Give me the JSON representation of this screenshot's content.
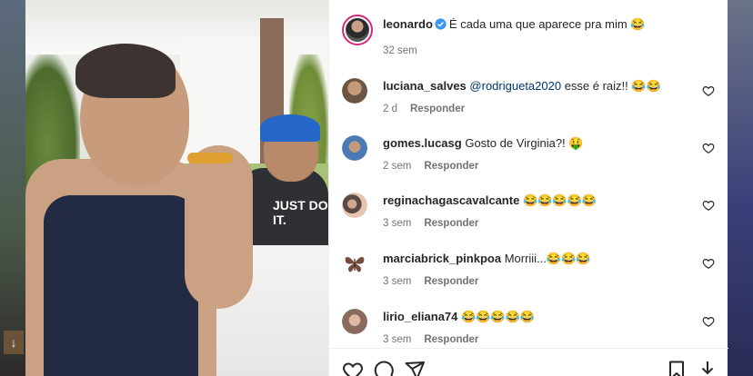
{
  "post": {
    "author": "leonardo",
    "caption": "É cada uma que aparece pra mim 😂",
    "time": "32 sem",
    "shirt_text": "JUST DO IT."
  },
  "reply_label": "Responder",
  "comments": [
    {
      "user": "luciana_salves",
      "mention": "@rodrigueta2020",
      "text": " esse é raiz!! 😂😂",
      "time": "2 d"
    },
    {
      "user": "gomes.lucasg",
      "mention": "",
      "text": "Gosto de Virginia?! 🤑",
      "time": "2 sem"
    },
    {
      "user": "reginachagascavalcante",
      "mention": "",
      "text": "😂😂😂😂😂",
      "time": "3 sem"
    },
    {
      "user": "marciabrick_pinkpoa",
      "mention": "",
      "text": "Morriii...😂😂😂",
      "time": "3 sem"
    },
    {
      "user": "lirio_eliana74",
      "mention": "",
      "text": "😂😂😂😂😂",
      "time": "3 sem"
    }
  ],
  "colors": {
    "verified": "#3897f0",
    "story_ring": "#d62976",
    "link": "#00376b",
    "muted": "#737373"
  },
  "icons": {
    "like": "heart-outline-icon",
    "comment": "speech-bubble-icon",
    "share": "paper-plane-icon",
    "save": "bookmark-icon",
    "download": "download-icon"
  }
}
